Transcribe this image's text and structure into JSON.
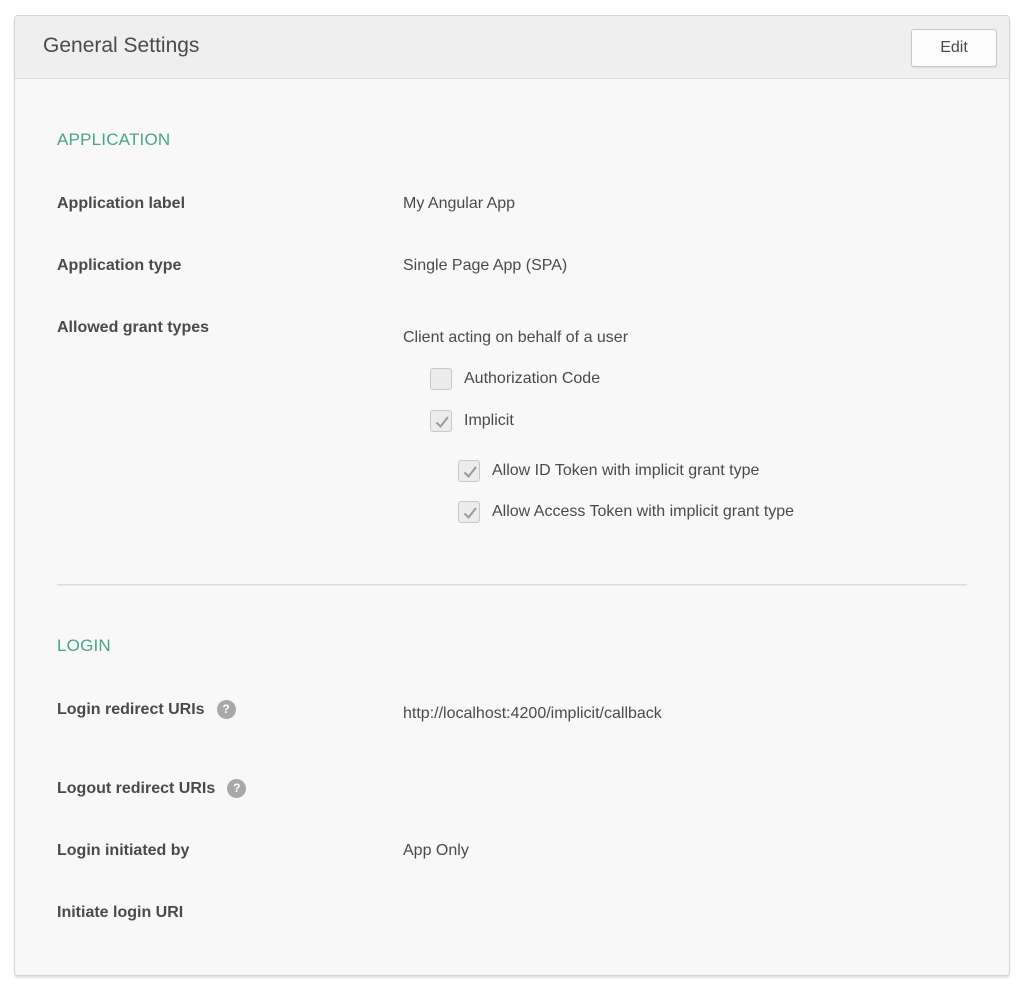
{
  "panel": {
    "title": "General Settings",
    "edit_label": "Edit"
  },
  "application": {
    "section_title": "APPLICATION",
    "fields": {
      "label": {
        "label": "Application label",
        "value": "My Angular App"
      },
      "type": {
        "label": "Application type",
        "value": "Single Page App (SPA)"
      },
      "grant_types": {
        "label": "Allowed grant types",
        "group_label": "Client acting on behalf of a user",
        "options": [
          {
            "label": "Authorization Code",
            "checked": false
          },
          {
            "label": "Implicit",
            "checked": true
          }
        ],
        "sub_options": [
          {
            "label": "Allow ID Token with implicit grant type",
            "checked": true
          },
          {
            "label": "Allow Access Token with implicit grant type",
            "checked": true
          }
        ]
      }
    }
  },
  "login": {
    "section_title": "LOGIN",
    "fields": {
      "redirect": {
        "label": "Login redirect URIs",
        "value": "http://localhost:4200/implicit/callback",
        "help_icon": "question-mark"
      },
      "logout": {
        "label": "Logout redirect URIs",
        "value": "",
        "help_icon": "question-mark"
      },
      "initiated_by": {
        "label": "Login initiated by",
        "value": "App Only"
      },
      "initiate_uri": {
        "label": "Initiate login URI",
        "value": ""
      }
    }
  },
  "colors": {
    "section_accent": "#4aa38a",
    "text": "#4a4a4a",
    "panel_bg": "#f8f8f8",
    "header_bg": "#efefef"
  }
}
